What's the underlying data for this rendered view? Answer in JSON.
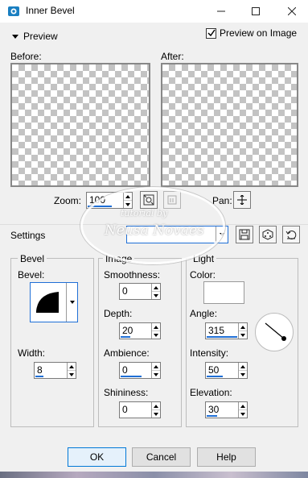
{
  "window": {
    "title": "Inner Bevel"
  },
  "preview_section": {
    "label": "Preview",
    "preview_on_image_label": "Preview on Image",
    "preview_on_image_checked": true
  },
  "panes": {
    "before_label": "Before:",
    "after_label": "After:"
  },
  "zoom": {
    "label": "Zoom:",
    "value": "100"
  },
  "pan": {
    "label": "Pan:"
  },
  "settings": {
    "label": "Settings",
    "preset_value": ""
  },
  "bevel_group": {
    "title": "Bevel",
    "bevel_label": "Bevel:",
    "width_label": "Width:",
    "width_value": "8"
  },
  "image_group": {
    "title": "Image",
    "smoothness_label": "Smoothness:",
    "smoothness_value": "0",
    "depth_label": "Depth:",
    "depth_value": "20",
    "ambience_label": "Ambience:",
    "ambience_value": "0",
    "shininess_label": "Shininess:",
    "shininess_value": "0"
  },
  "light_group": {
    "title": "Light",
    "color_label": "Color:",
    "color_value": "#ffffff",
    "angle_label": "Angle:",
    "angle_value": "315",
    "intensity_label": "Intensity:",
    "intensity_value": "50",
    "elevation_label": "Elevation:",
    "elevation_value": "30"
  },
  "buttons": {
    "ok": "OK",
    "cancel": "Cancel",
    "help": "Help"
  },
  "watermark": {
    "line1": "tutorial by",
    "line2": "Neusa Novaes"
  },
  "colors": {
    "accent": "#1f6fd6",
    "dialog_bg": "#f0f0f0"
  }
}
